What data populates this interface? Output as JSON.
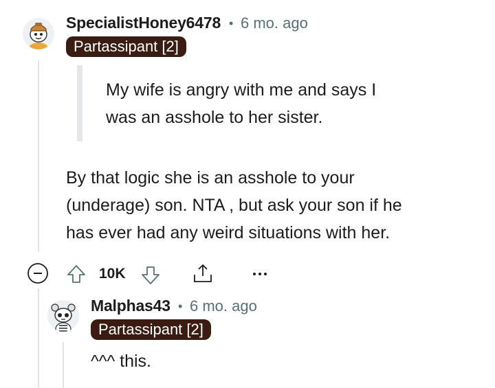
{
  "comment": {
    "username": "SpecialistHoney6478",
    "separator": "•",
    "time": "6 mo. ago",
    "flair": "Partassipant [2]",
    "quote_lines": [
      "My wife is angry with me and says I",
      "was an asshole to her sister."
    ],
    "body_lines": [
      "By that logic she is an asshole to your",
      "(underage) son. NTA , but ask your son if he",
      "has ever had any weird situations with her."
    ],
    "actions": {
      "collapse_icon": "minus-circle-icon",
      "upvote_icon": "arrow-up-icon",
      "votes": "10K",
      "downvote_icon": "arrow-down-icon",
      "share_icon": "share-icon",
      "more_icon": "ellipsis-icon"
    }
  },
  "reply": {
    "username": "Malphas43",
    "separator": "•",
    "time": "6 mo. ago",
    "flair": "Partassipant [2]",
    "body": "^^^ this."
  },
  "colors": {
    "flair_bg": "#3a1c13",
    "meta_text": "#576f76",
    "thread_line": "#e1e4e6",
    "text": "#1c1c1c"
  }
}
